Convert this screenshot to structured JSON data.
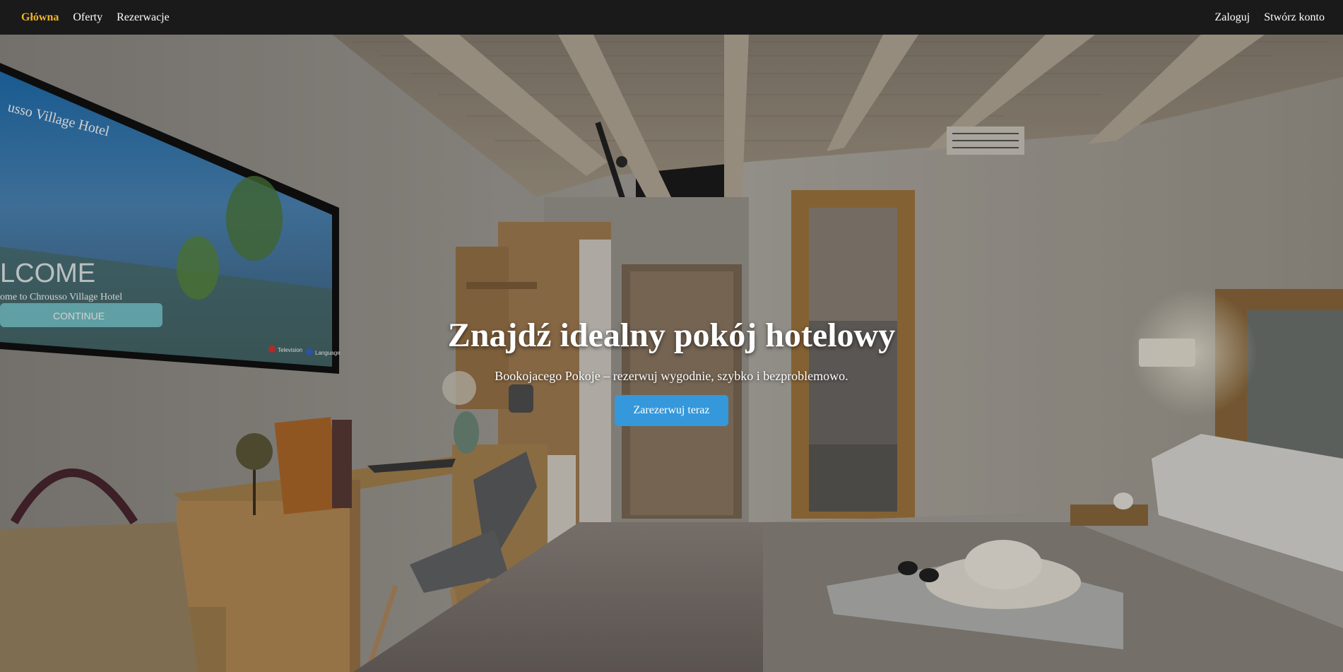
{
  "nav": {
    "left": [
      {
        "label": "Główna",
        "active": true
      },
      {
        "label": "Oferty",
        "active": false
      },
      {
        "label": "Rezerwacje",
        "active": false
      }
    ],
    "right": [
      {
        "label": "Zaloguj"
      },
      {
        "label": "Stwórz konto"
      }
    ]
  },
  "hero": {
    "title": "Znajdź idealny pokój hotelowy",
    "subtitle": "Bookojacego Pokoje – rezerwuj wygodnie, szybko i bezproblemowo.",
    "button_label": "Zarezerwuj teraz",
    "tv_screen": {
      "hotel_name": "usso Village Hotel",
      "welcome": "LCOME",
      "subtitle": "ome to Chrousso Village Hotel",
      "continue": "CONTINUE",
      "television": "Television",
      "language": "Language"
    }
  },
  "colors": {
    "navbar_bg": "#1a1a1a",
    "active_link": "#f0b429",
    "button_bg": "#3498db"
  }
}
